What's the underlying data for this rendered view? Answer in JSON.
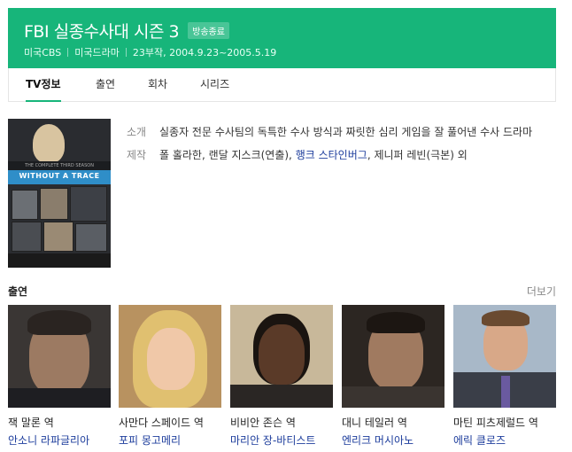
{
  "header": {
    "title": "FBI 실종수사대 시즌 3",
    "badge": "방송종료",
    "network": "미국CBS",
    "genre": "미국드라마",
    "episodes": "23부작, 2004.9.23~2005.5.19"
  },
  "tabs": [
    {
      "label": "TV정보",
      "active": true
    },
    {
      "label": "출연",
      "active": false
    },
    {
      "label": "회차",
      "active": false
    },
    {
      "label": "시리즈",
      "active": false
    }
  ],
  "poster": {
    "subtitle": "THE COMPLETE THIRD SEASON",
    "title": "WITHOUT A TRACE"
  },
  "info": {
    "intro_label": "소개",
    "intro_text": "실종자 전문 수사팀의 독특한 수사 방식과 짜릿한 심리 게임을 잘 풀어낸 수사 드라마",
    "prod_label": "제작",
    "prod_part1": "폴 홀라한, 랜달 지스크(연출), ",
    "prod_link": "행크 스타인버그",
    "prod_part2": ", 제니퍼 레빈(극본) 외"
  },
  "cast_section": {
    "title": "출연",
    "more": "더보기",
    "members": [
      {
        "role": "잭 말론 역",
        "actor": "안소니 라파글리아"
      },
      {
        "role": "사만다 스페이드 역",
        "actor": "포피 몽고메리"
      },
      {
        "role": "비비안 존슨 역",
        "actor": "마리안 장-바티스트"
      },
      {
        "role": "대니 테일러 역",
        "actor": "엔리크 머시아노"
      },
      {
        "role": "마틴 피츠제럴드 역",
        "actor": "에릭 클로즈"
      }
    ]
  },
  "colors": {
    "brand": "#17b57a",
    "link": "#1d3d9c"
  }
}
